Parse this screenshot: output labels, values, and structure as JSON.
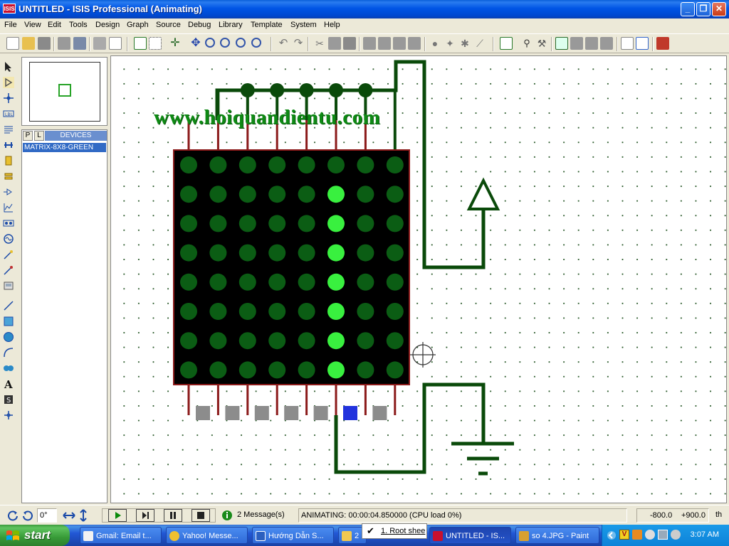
{
  "window": {
    "app_icon_text": "ISIS",
    "title": "UNTITLED - ISIS Professional (Animating)"
  },
  "menu": [
    "File",
    "View",
    "Edit",
    "Tools",
    "Design",
    "Graph",
    "Source",
    "Debug",
    "Library",
    "Template",
    "System",
    "Help"
  ],
  "panel": {
    "p_label": "P",
    "l_label": "L",
    "devices_title": "DEVICES",
    "device_items": [
      "MATRIX-8X8-GREEN"
    ]
  },
  "canvas": {
    "watermark": "www.hoiquandientu.com",
    "led_matrix": {
      "rows": 8,
      "cols": 8,
      "lit_column": 6,
      "lit_rows": [
        2,
        3,
        4,
        5,
        6,
        7,
        8
      ],
      "colors": {
        "off": "#0b5d14",
        "on": "#39f03f",
        "body": "#000000",
        "border": "#8b1a1a",
        "wire": "#0a4a0a"
      }
    },
    "bottom_pins": {
      "count": 8,
      "active_pin": 6,
      "colors": {
        "inactive": "#8c8c8c",
        "active": "#2233dd"
      }
    }
  },
  "statusbar": {
    "rotation_value": "0°",
    "messages": "2 Message(s)",
    "status": "ANIMATING: 00:00:04.850000 (CPU load 0%)",
    "coord_x": "-800.0",
    "coord_y": "+900.0",
    "units": "th"
  },
  "taskbar": {
    "start_label": "start",
    "tasks": [
      "Gmail: Email t...",
      "Yahoo! Messe...",
      "Hướng Dẫn S...",
      "2",
      "UNTITLED - IS...",
      "so 4.JPG - Paint"
    ],
    "sheet_tooltip": "1. Root shee",
    "clock": "3:07 AM"
  }
}
